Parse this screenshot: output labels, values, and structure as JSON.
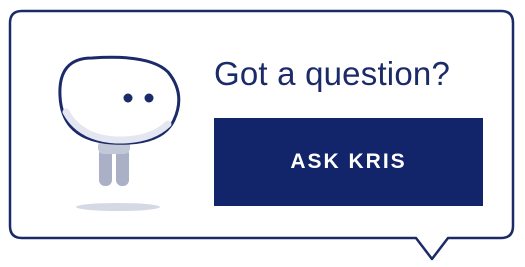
{
  "widget": {
    "heading": "Got a question?",
    "button_label": "ASK KRIS",
    "mascot_icon": "robot-mascot-icon"
  },
  "colors": {
    "border": "#1b2a68",
    "button_background": "#12246a",
    "button_text": "#ffffff",
    "heading_text": "#1b2a68",
    "mascot_head": "#ffffff",
    "mascot_body": "#aab0c6",
    "mascot_shadow": "#d5d9e6"
  }
}
